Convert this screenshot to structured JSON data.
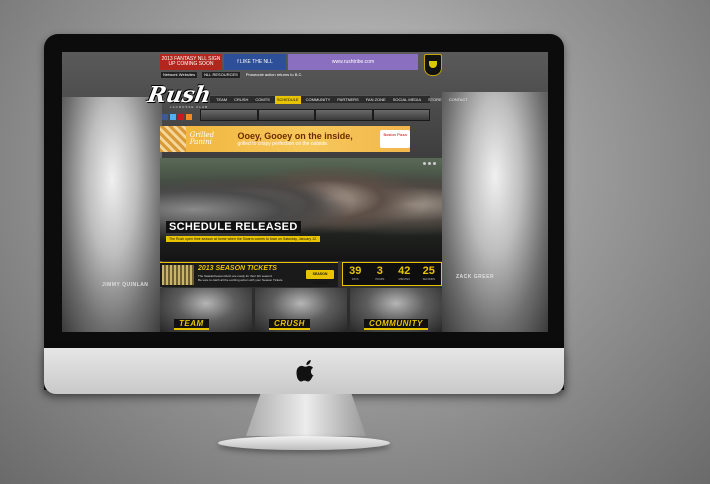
{
  "colors": {
    "accent": "#e8c400",
    "promo": "#f2b64c",
    "screen_bg": "#2a2a2a"
  },
  "device": {
    "logo_icon": "apple-logo-icon"
  },
  "site": {
    "top_ads": [
      {
        "label": "2013 FANTASY NLL SIGN UP COMING SOON",
        "bg": "#b3261e"
      },
      {
        "label": "f LIKE THE NLL",
        "bg": "#2d4e98"
      },
      {
        "label": "www.rushtribe.com",
        "bg": "#8a6fc0"
      }
    ],
    "network_select": "Network Websites",
    "nll_resources": "NLL RESOURCES",
    "ticker": "Prosecute action returns to B.C.",
    "logo": "Rush",
    "logo_sub": "LACROSSE CLUB",
    "nav": [
      "TEAM",
      "CRUSH",
      "COMTS",
      "SCHEDULE",
      "COMMUNITY",
      "PARTNERS",
      "FAN ZONE",
      "SOCIAL MEDIA",
      "STORE",
      "CONTACT"
    ],
    "nav_active": "SCHEDULE",
    "social_icons": [
      "facebook-icon",
      "twitter-icon",
      "youtube-icon",
      "rss-icon"
    ],
    "promo": {
      "brand": "Grilled Panini",
      "headline": "Ooey, Gooey on the inside,",
      "subline": "grilled to crispy perfection on the outside.",
      "partner": "Boston Pizza"
    },
    "hero": {
      "title": "SCHEDULE RELEASED",
      "subtitle": "The Rush open their season at home when the Swarm comes to town on Saturday, January 12."
    },
    "tickets": {
      "title": "2013 SEASON TICKETS",
      "line1": "The Saskatchewan Rush are ready for their 4th season!",
      "line2": "Be sure to catch all the exciting action with your Season Tickets.",
      "button": "SEASON TICKETS"
    },
    "countdown": [
      {
        "value": "39",
        "unit": "DAYS"
      },
      {
        "value": "3",
        "unit": "HOURS"
      },
      {
        "value": "42",
        "unit": "MINUTES"
      },
      {
        "value": "25",
        "unit": "SECONDS"
      }
    ],
    "tiles": [
      "TEAM",
      "CRUSH",
      "COMMUNITY"
    ],
    "athlete_left": "JIMMY QUINLAN",
    "athlete_right": "ZACK GREER"
  }
}
